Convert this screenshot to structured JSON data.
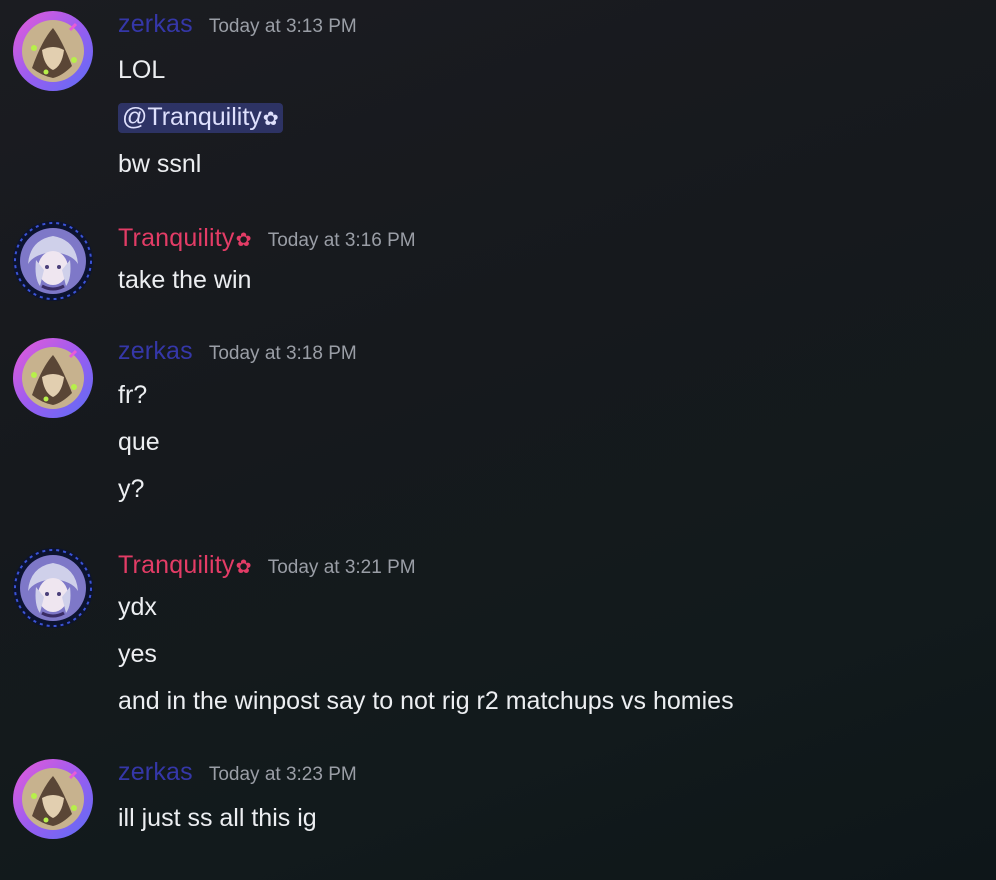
{
  "colors": {
    "zerkas_name": "#3537a8",
    "tranquility_name": "#e33c66",
    "timestamp": "#9a9ea6",
    "message_text": "#eceef1",
    "mention_bg": "#3c4275"
  },
  "messages": [
    {
      "author": "zerkas",
      "timestamp": "Today at 3:13 PM",
      "lines": [
        "LOL",
        "@Tranquility",
        "bw ssnl"
      ]
    },
    {
      "author": "Tranquility",
      "timestamp": "Today at 3:16 PM",
      "lines": [
        "take the win"
      ]
    },
    {
      "author": "zerkas",
      "timestamp": "Today at 3:18 PM",
      "lines": [
        "fr?",
        "que",
        "y?"
      ]
    },
    {
      "author": "Tranquility",
      "timestamp": "Today at 3:21 PM",
      "lines": [
        "ydx",
        "yes",
        "and in the winpost say to not rig r2 matchups vs homies"
      ]
    },
    {
      "author": "zerkas",
      "timestamp": "Today at 3:23 PM",
      "lines": [
        "ill just ss all this ig"
      ]
    }
  ],
  "icons": {
    "flower": "flower-icon",
    "avatar_zerkas": "avatar-zerkas",
    "avatar_tranquility": "avatar-tranquility"
  }
}
